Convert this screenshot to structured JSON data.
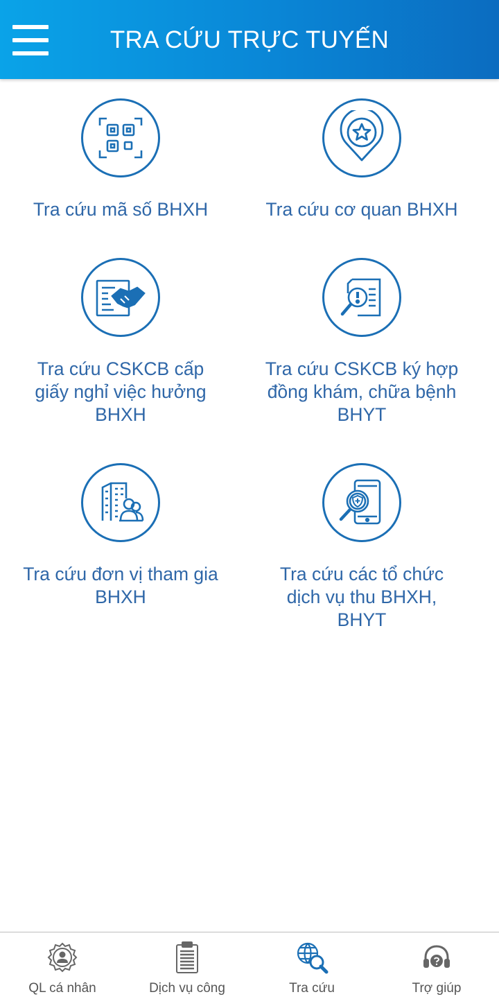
{
  "header": {
    "title": "TRA CỨU TRỰC TUYẾN",
    "menu_icon": "hamburger-menu-icon",
    "colors": {
      "gradient_start": "#0aa3e8",
      "gradient_end": "#0b6cc0"
    }
  },
  "tiles": [
    {
      "label": "Tra cứu mã số BHXH",
      "icon": "qr-scan-icon"
    },
    {
      "label": "Tra cứu cơ quan BHXH",
      "icon": "location-star-icon"
    },
    {
      "label": "Tra cứu CSKCB cấp\ngiấy nghỉ việc hưởng\nBHXH",
      "icon": "handshake-document-icon"
    },
    {
      "label": "Tra cứu CSKCB ký hợp\nđồng khám, chữa bệnh\nBHYT",
      "icon": "document-search-alert-icon"
    },
    {
      "label": "Tra cứu đơn vị tham gia\nBHXH",
      "icon": "building-people-icon"
    },
    {
      "label": "Tra cứu các tổ chức\ndịch vụ thu BHXH,\nBHYT",
      "icon": "phone-shield-search-icon"
    }
  ],
  "bottom_nav": [
    {
      "label": "QL cá nhân",
      "icon": "gear-user-icon",
      "active": false
    },
    {
      "label": "Dịch vụ công",
      "icon": "clipboard-icon",
      "active": false
    },
    {
      "label": "Tra cứu",
      "icon": "globe-search-icon",
      "active": true
    },
    {
      "label": "Trợ giúp",
      "icon": "headset-help-icon",
      "active": false
    }
  ],
  "colors": {
    "accent": "#1b6fb5",
    "label": "#2f67a8",
    "nav_label": "#555555"
  }
}
